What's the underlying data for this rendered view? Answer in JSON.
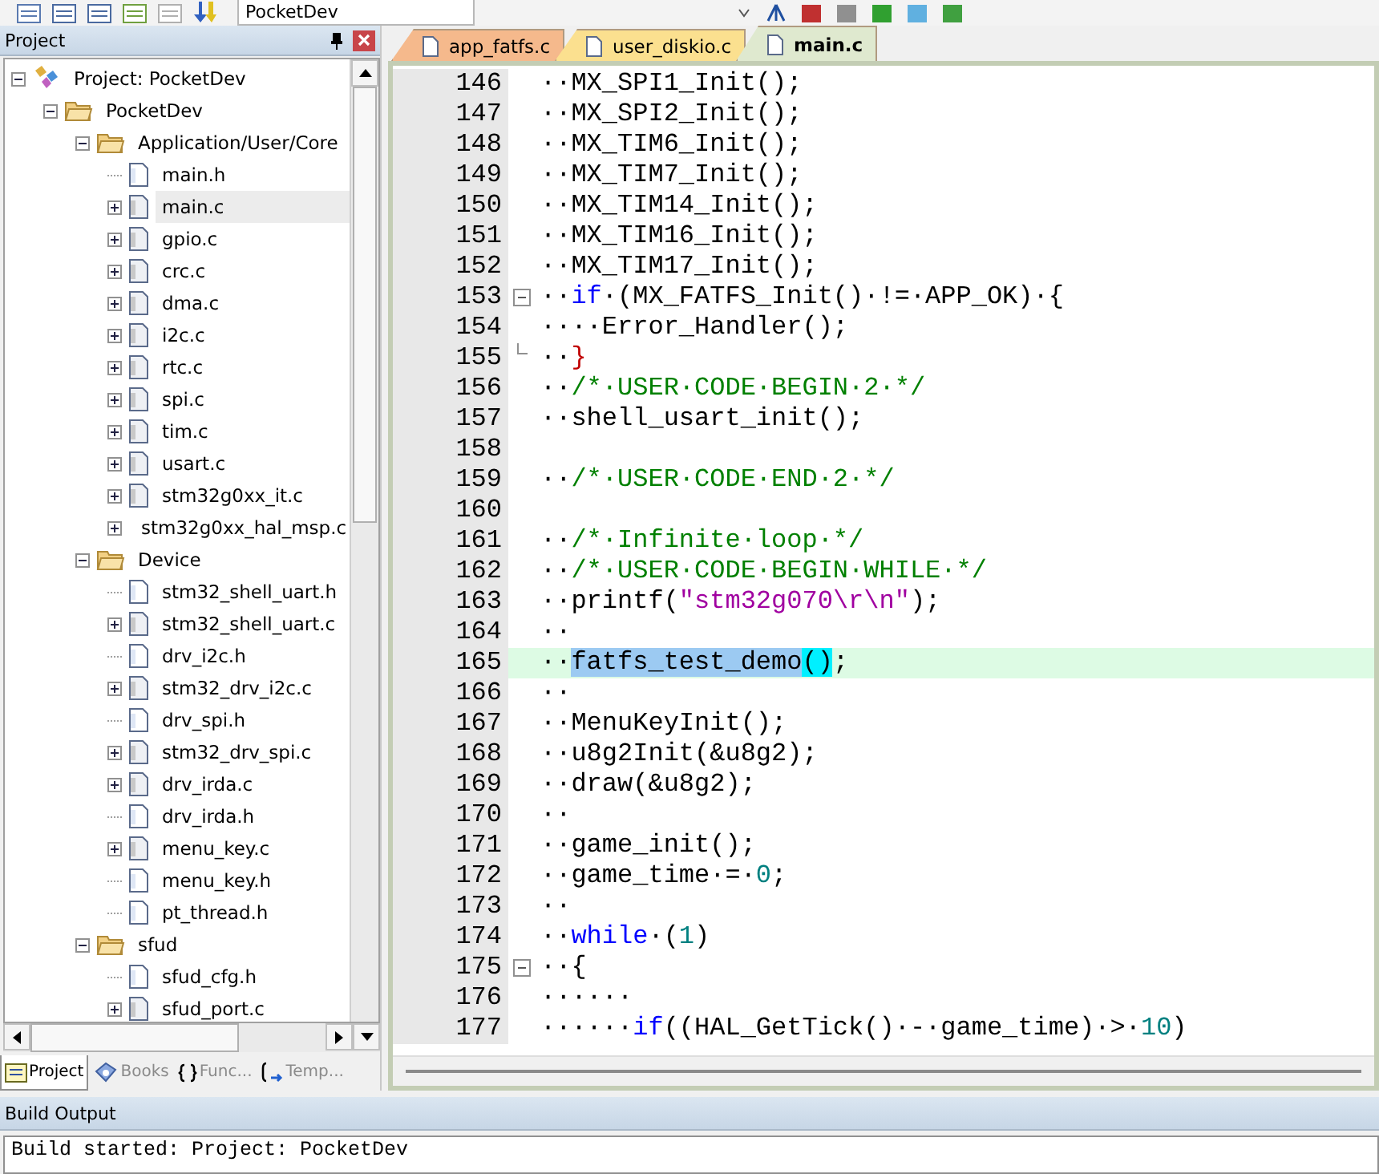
{
  "toolbar": {
    "target": "PocketDev"
  },
  "project_panel": {
    "title": "Project",
    "tree": [
      {
        "label": "Project: PocketDev",
        "kind": "project",
        "expanded": true,
        "selected": false,
        "children": [
          {
            "label": "PocketDev",
            "kind": "target",
            "expanded": true,
            "selected": false,
            "children": [
              {
                "label": "Application/User/Core",
                "kind": "folder",
                "expanded": true,
                "selected": false,
                "children": [
                  {
                    "label": "main.h",
                    "kind": "header",
                    "selected": false
                  },
                  {
                    "label": "main.c",
                    "kind": "source",
                    "expanded": false,
                    "selected": true
                  },
                  {
                    "label": "gpio.c",
                    "kind": "source",
                    "expanded": false,
                    "selected": false
                  },
                  {
                    "label": "crc.c",
                    "kind": "source",
                    "expanded": false,
                    "selected": false
                  },
                  {
                    "label": "dma.c",
                    "kind": "source",
                    "expanded": false,
                    "selected": false
                  },
                  {
                    "label": "i2c.c",
                    "kind": "source",
                    "expanded": false,
                    "selected": false
                  },
                  {
                    "label": "rtc.c",
                    "kind": "source",
                    "expanded": false,
                    "selected": false
                  },
                  {
                    "label": "spi.c",
                    "kind": "source",
                    "expanded": false,
                    "selected": false
                  },
                  {
                    "label": "tim.c",
                    "kind": "source",
                    "expanded": false,
                    "selected": false
                  },
                  {
                    "label": "usart.c",
                    "kind": "source",
                    "expanded": false,
                    "selected": false
                  },
                  {
                    "label": "stm32g0xx_it.c",
                    "kind": "source",
                    "expanded": false,
                    "selected": false
                  },
                  {
                    "label": "stm32g0xx_hal_msp.c",
                    "kind": "source",
                    "expanded": false,
                    "selected": false
                  }
                ]
              },
              {
                "label": "Device",
                "kind": "folder",
                "expanded": true,
                "selected": false,
                "children": [
                  {
                    "label": "stm32_shell_uart.h",
                    "kind": "header",
                    "selected": false
                  },
                  {
                    "label": "stm32_shell_uart.c",
                    "kind": "source",
                    "expanded": false,
                    "selected": false
                  },
                  {
                    "label": "drv_i2c.h",
                    "kind": "header",
                    "selected": false
                  },
                  {
                    "label": "stm32_drv_i2c.c",
                    "kind": "source",
                    "expanded": false,
                    "selected": false
                  },
                  {
                    "label": "drv_spi.h",
                    "kind": "header",
                    "selected": false
                  },
                  {
                    "label": "stm32_drv_spi.c",
                    "kind": "source",
                    "expanded": false,
                    "selected": false
                  },
                  {
                    "label": "drv_irda.c",
                    "kind": "source",
                    "expanded": false,
                    "selected": false
                  },
                  {
                    "label": "drv_irda.h",
                    "kind": "header",
                    "selected": false
                  },
                  {
                    "label": "menu_key.c",
                    "kind": "source",
                    "expanded": false,
                    "selected": false
                  },
                  {
                    "label": "menu_key.h",
                    "kind": "header",
                    "selected": false
                  },
                  {
                    "label": "pt_thread.h",
                    "kind": "header",
                    "selected": false
                  }
                ]
              },
              {
                "label": "sfud",
                "kind": "folder",
                "expanded": true,
                "selected": false,
                "children": [
                  {
                    "label": "sfud_cfg.h",
                    "kind": "header",
                    "selected": false
                  },
                  {
                    "label": "sfud_port.c",
                    "kind": "source",
                    "expanded": false,
                    "selected": false
                  }
                ]
              }
            ]
          }
        ]
      }
    ],
    "tabs": [
      {
        "label": "Project",
        "kind": "project",
        "selected": true
      },
      {
        "label": "Books",
        "kind": "books",
        "selected": false
      },
      {
        "label": "Func...",
        "kind": "functions",
        "selected": false
      },
      {
        "label": "Temp...",
        "kind": "templates",
        "selected": false
      }
    ]
  },
  "editor": {
    "tabs": [
      {
        "label": "app_fatfs.c",
        "color": "#f5b98c",
        "selected": false
      },
      {
        "label": "user_diskio.c",
        "color": "#fbe08f",
        "selected": false
      },
      {
        "label": "main.c",
        "color": "#dfe9cf",
        "selected": true
      }
    ],
    "lines": [
      {
        "number": "146",
        "current": false,
        "segments": [
          {
            "kind": "plain",
            "text": "··MX_SPI1_Init();"
          }
        ]
      },
      {
        "number": "147",
        "current": false,
        "segments": [
          {
            "kind": "plain",
            "text": "··MX_SPI2_Init();"
          }
        ]
      },
      {
        "number": "148",
        "current": false,
        "segments": [
          {
            "kind": "plain",
            "text": "··MX_TIM6_Init();"
          }
        ]
      },
      {
        "number": "149",
        "current": false,
        "segments": [
          {
            "kind": "plain",
            "text": "··MX_TIM7_Init();"
          }
        ]
      },
      {
        "number": "150",
        "current": false,
        "segments": [
          {
            "kind": "plain",
            "text": "··MX_TIM14_Init();"
          }
        ]
      },
      {
        "number": "151",
        "current": false,
        "segments": [
          {
            "kind": "plain",
            "text": "··MX_TIM16_Init();"
          }
        ]
      },
      {
        "number": "152",
        "current": false,
        "segments": [
          {
            "kind": "plain",
            "text": "··MX_TIM17_Init();"
          }
        ]
      },
      {
        "number": "153",
        "current": false,
        "fold_start": true,
        "segments": [
          {
            "kind": "plain",
            "text": "··"
          },
          {
            "kind": "keyword",
            "text": "if"
          },
          {
            "kind": "plain",
            "text": "·(MX_FATFS_Init()·!=·APP_OK)·{"
          }
        ]
      },
      {
        "number": "154",
        "current": false,
        "segments": [
          {
            "kind": "plain",
            "text": "····Error_Handler();"
          }
        ]
      },
      {
        "number": "155",
        "current": false,
        "fold_end": true,
        "segments": [
          {
            "kind": "plain",
            "text": "··"
          },
          {
            "kind": "brace",
            "text": "}"
          }
        ]
      },
      {
        "number": "156",
        "current": false,
        "segments": [
          {
            "kind": "plain",
            "text": "··"
          },
          {
            "kind": "comment",
            "text": "/*·USER·CODE·BEGIN·2·*/"
          }
        ]
      },
      {
        "number": "157",
        "current": false,
        "segments": [
          {
            "kind": "plain",
            "text": "··shell_usart_init();"
          }
        ]
      },
      {
        "number": "158",
        "current": false
      },
      {
        "number": "159",
        "current": false,
        "segments": [
          {
            "kind": "plain",
            "text": "··"
          },
          {
            "kind": "comment",
            "text": "/*·USER·CODE·END·2·*/"
          }
        ]
      },
      {
        "number": "160",
        "current": false
      },
      {
        "number": "161",
        "current": false,
        "segments": [
          {
            "kind": "plain",
            "text": "··"
          },
          {
            "kind": "comment",
            "text": "/*·Infinite·loop·*/"
          }
        ]
      },
      {
        "number": "162",
        "current": false,
        "segments": [
          {
            "kind": "plain",
            "text": "··"
          },
          {
            "kind": "comment",
            "text": "/*·USER·CODE·BEGIN·WHILE·*/"
          }
        ]
      },
      {
        "number": "163",
        "current": false,
        "segments": [
          {
            "kind": "plain",
            "text": "··printf("
          },
          {
            "kind": "string",
            "text": "\"stm32g070\\r\\n\""
          },
          {
            "kind": "plain",
            "text": ");"
          }
        ]
      },
      {
        "number": "164",
        "current": false,
        "segments": [
          {
            "kind": "plain",
            "text": "··"
          }
        ]
      },
      {
        "number": "165",
        "current": true,
        "segments": [
          {
            "kind": "plain",
            "text": "··"
          },
          {
            "kind": "selected",
            "text": "fatfs_test_demo"
          },
          {
            "kind": "match",
            "text": "()"
          },
          {
            "kind": "plain",
            "text": ";"
          }
        ]
      },
      {
        "number": "166",
        "current": false,
        "segments": [
          {
            "kind": "plain",
            "text": "··"
          }
        ]
      },
      {
        "number": "167",
        "current": false,
        "segments": [
          {
            "kind": "plain",
            "text": "··MenuKeyInit();"
          }
        ]
      },
      {
        "number": "168",
        "current": false,
        "segments": [
          {
            "kind": "plain",
            "text": "··u8g2Init(&u8g2);"
          }
        ]
      },
      {
        "number": "169",
        "current": false,
        "segments": [
          {
            "kind": "plain",
            "text": "··draw(&u8g2);"
          }
        ]
      },
      {
        "number": "170",
        "current": false,
        "segments": [
          {
            "kind": "plain",
            "text": "··"
          }
        ]
      },
      {
        "number": "171",
        "current": false,
        "segments": [
          {
            "kind": "plain",
            "text": "··game_init();"
          }
        ]
      },
      {
        "number": "172",
        "current": false,
        "segments": [
          {
            "kind": "plain",
            "text": "··game_time·=·"
          },
          {
            "kind": "number",
            "text": "0"
          },
          {
            "kind": "plain",
            "text": ";"
          }
        ]
      },
      {
        "number": "173",
        "current": false,
        "segments": [
          {
            "kind": "plain",
            "text": "··"
          }
        ]
      },
      {
        "number": "174",
        "current": false,
        "segments": [
          {
            "kind": "plain",
            "text": "··"
          },
          {
            "kind": "keyword",
            "text": "while"
          },
          {
            "kind": "plain",
            "text": "·("
          },
          {
            "kind": "number",
            "text": "1"
          },
          {
            "kind": "plain",
            "text": ")"
          }
        ]
      },
      {
        "number": "175",
        "current": false,
        "fold_start": true,
        "segments": [
          {
            "kind": "plain",
            "text": "··{"
          }
        ]
      },
      {
        "number": "176",
        "current": false,
        "segments": [
          {
            "kind": "plain",
            "text": "······"
          }
        ]
      },
      {
        "number": "177",
        "current": false,
        "segments": [
          {
            "kind": "plain",
            "text": "······"
          },
          {
            "kind": "keyword",
            "text": "if"
          },
          {
            "kind": "plain",
            "text": "((HAL_GetTick()·-·game_time)·>·"
          },
          {
            "kind": "number",
            "text": "10"
          },
          {
            "kind": "plain",
            "text": ")"
          }
        ]
      }
    ]
  },
  "build_output": {
    "title": "Build Output",
    "lines": [
      "Build started: Project: PocketDev"
    ]
  }
}
